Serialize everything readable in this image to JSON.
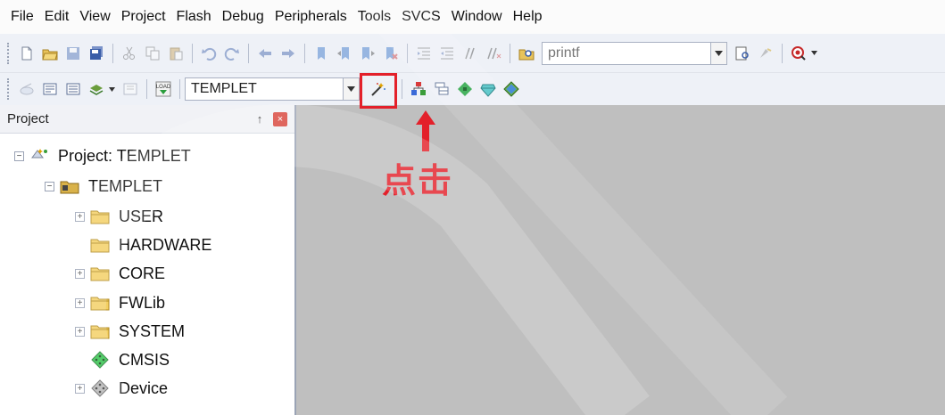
{
  "menubar": {
    "items": [
      "File",
      "Edit",
      "View",
      "Project",
      "Flash",
      "Debug",
      "Peripherals",
      "Tools",
      "SVCS",
      "Window",
      "Help"
    ]
  },
  "toolbar1": {
    "find_value": "printf"
  },
  "toolbar2": {
    "target_value": "TEMPLET"
  },
  "project_panel": {
    "title": "Project",
    "pin_glyph": "↑",
    "close_glyph": "×",
    "tree": [
      {
        "label": "Project: TEMPLET",
        "expander": "−",
        "icon": "project-icon"
      },
      {
        "label": "TEMPLET",
        "expander": "−",
        "icon": "target-folder-icon"
      },
      {
        "label": "USER",
        "expander": "+",
        "icon": "folder-icon"
      },
      {
        "label": "HARDWARE",
        "expander": "",
        "icon": "folder-icon"
      },
      {
        "label": "CORE",
        "expander": "+",
        "icon": "folder-icon"
      },
      {
        "label": "FWLib",
        "expander": "+",
        "icon": "folder-icon"
      },
      {
        "label": "SYSTEM",
        "expander": "+",
        "icon": "folder-icon"
      },
      {
        "label": "CMSIS",
        "expander": "",
        "icon": "cmsis-green-diamond-icon"
      },
      {
        "label": "Device",
        "expander": "+",
        "icon": "device-gray-diamond-icon"
      }
    ]
  },
  "annotation": {
    "text": "点击",
    "color": "#e3202a"
  }
}
